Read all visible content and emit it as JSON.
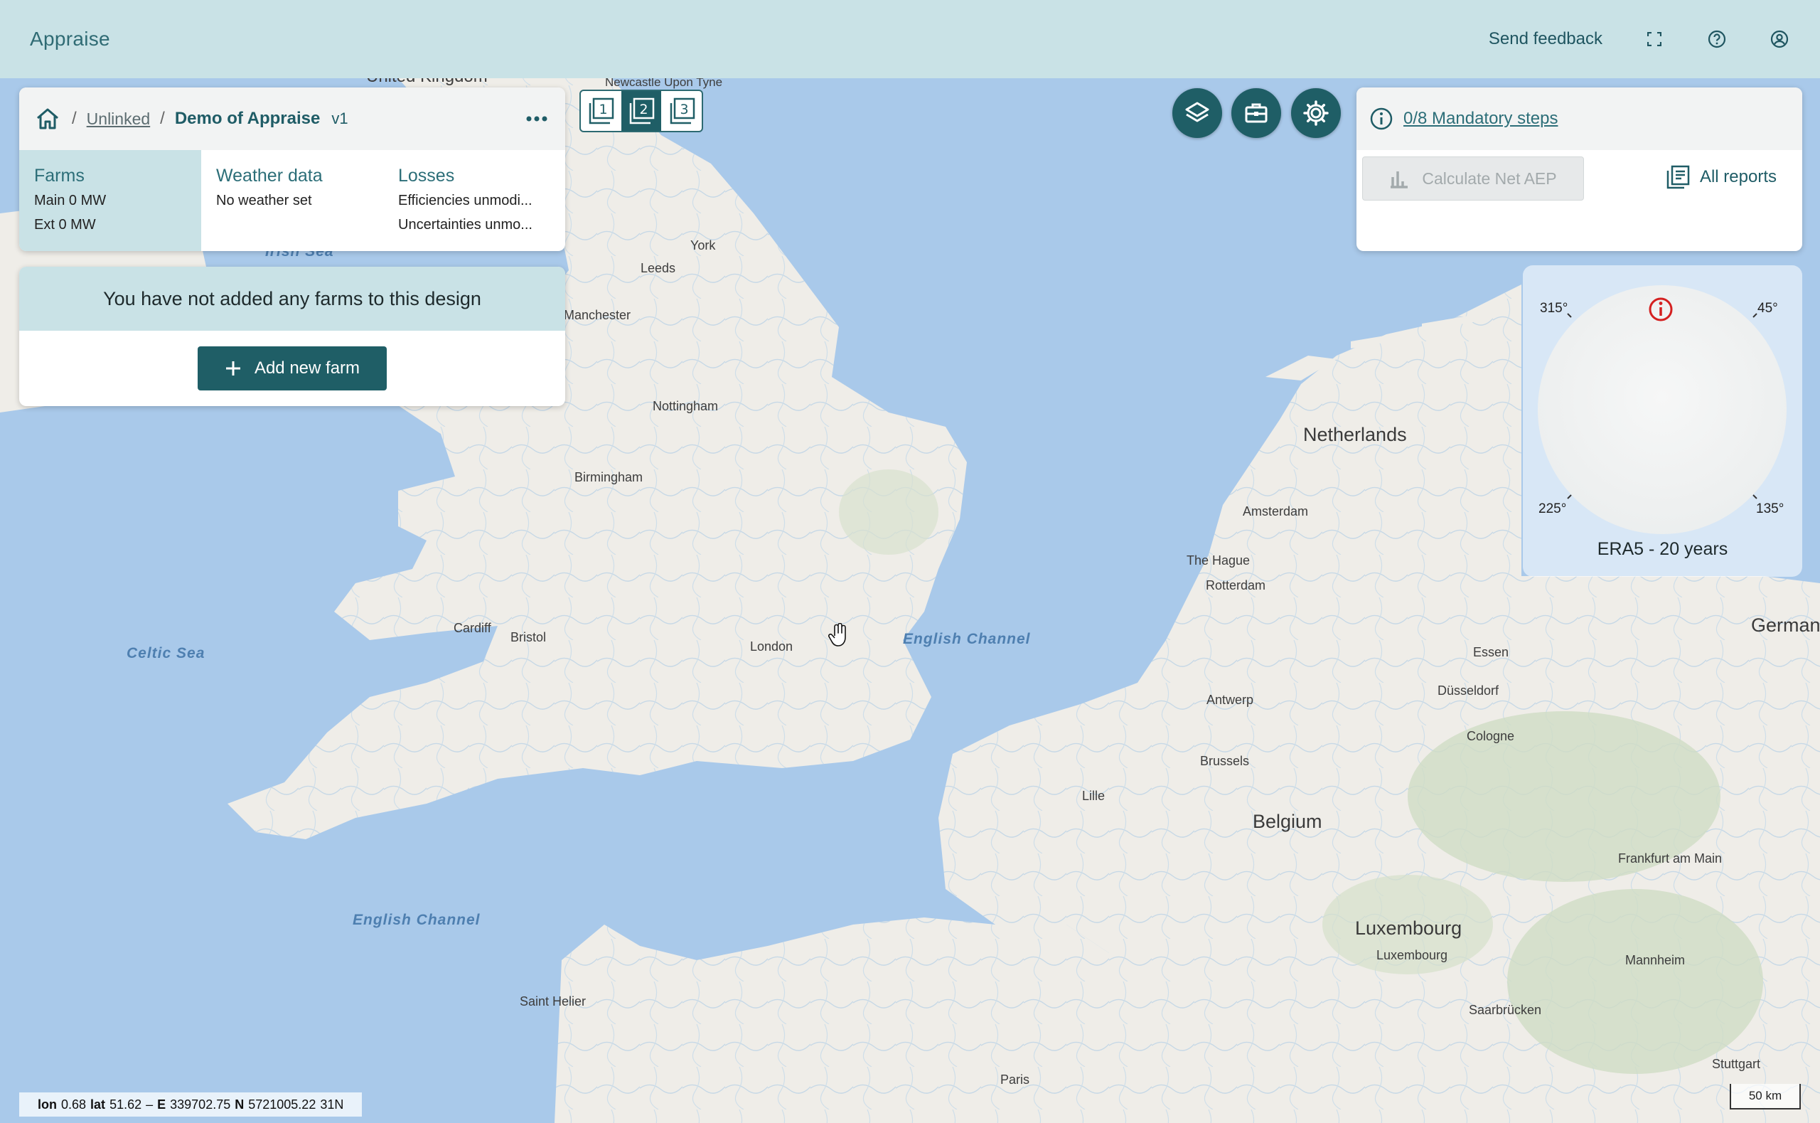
{
  "app": {
    "title": "Appraise"
  },
  "topbar": {
    "feedback_label": "Send feedback",
    "icons": [
      "fullscreen-icon",
      "help-icon",
      "account-icon"
    ]
  },
  "breadcrumb": {
    "home_icon": "home-icon",
    "project": "Unlinked",
    "design": "Demo of Appraise",
    "version": "v1",
    "menu_icon": "more-horizontal-icon"
  },
  "design_tabs": {
    "farms": {
      "title": "Farms",
      "line1": "Main 0 MW",
      "line2": "Ext 0 MW"
    },
    "weather": {
      "title": "Weather data",
      "line1": "No weather set"
    },
    "losses": {
      "title": "Losses",
      "line1": "Efficiencies unmodi...",
      "line2": "Uncertainties unmo..."
    }
  },
  "farms_panel": {
    "empty_message": "You have not added any farms to this design",
    "add_button": "Add new farm"
  },
  "layout_buttons": [
    "1",
    "2",
    "3"
  ],
  "layout_active": 2,
  "tool_buttons": [
    "layers-icon",
    "toolbox-icon",
    "settings-gear-icon"
  ],
  "steps": {
    "mandatory_link": "0/8 Mandatory steps",
    "calculate_label": "Calculate Net AEP",
    "all_reports_label": "All reports"
  },
  "windrose": {
    "deg_315": "315°",
    "deg_45": "45°",
    "deg_225": "225°",
    "deg_135": "135°",
    "source_label": "ERA5 - 20 years"
  },
  "map": {
    "places": {
      "united_kingdom": "United Kingdom",
      "newcastle": "Newcastle Upon Tyne",
      "irish_sea": "Irish Sea",
      "york": "York",
      "leeds": "Leeds",
      "manchester": "Manchester",
      "nottingham": "Nottingham",
      "birmingham": "Birmingham",
      "cardiff": "Cardiff",
      "bristol": "Bristol",
      "celtic_sea": "Celtic Sea",
      "london": "London",
      "english_channel_east": "English Channel",
      "english_channel_west": "English Channel",
      "saint_helier": "Saint Helier",
      "paris": "Paris",
      "netherlands": "Netherlands",
      "amsterdam": "Amsterdam",
      "the_hague": "The Hague",
      "rotterdam": "Rotterdam",
      "antwerp": "Antwerp",
      "brussels": "Brussels",
      "lille": "Lille",
      "belgium": "Belgium",
      "essen": "Essen",
      "dusseldorf": "Düsseldorf",
      "cologne": "Cologne",
      "germany": "German",
      "frankfurt": "Frankfurt am Main",
      "luxembourg_country": "Luxembourg",
      "luxembourg_city": "Luxembourg",
      "mannheim": "Mannheim",
      "saarbrucken": "Saarbrücken",
      "stuttgart": "Stuttgart"
    },
    "coords": {
      "lon_label": "lon",
      "lon": "0.68",
      "lat_label": "lat",
      "lat": "51.62",
      "sep": "–",
      "e_label": "E",
      "e": "339702.75",
      "n_label": "N",
      "n": "5721005.22",
      "zone": "31N"
    },
    "scale_label": "50 km"
  }
}
